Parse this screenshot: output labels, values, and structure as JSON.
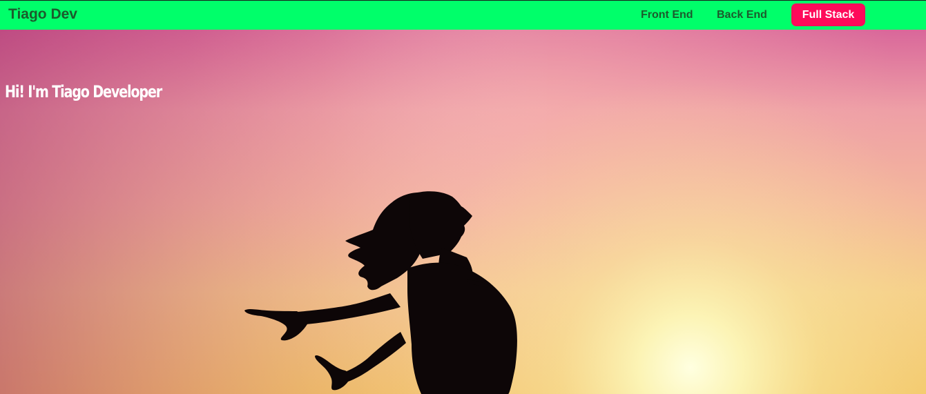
{
  "navbar": {
    "brand": "Tiago Dev",
    "links": [
      {
        "label": "Front End"
      },
      {
        "label": "Back End"
      },
      {
        "label": "Full Stack"
      }
    ],
    "colors": {
      "background": "#00ff6a",
      "link_text": "#1c5a2c",
      "active_button": "#ff0a5a"
    }
  },
  "hero": {
    "heading": "Hi! I'm Tiago Developer",
    "image": "sunset-silhouette-woman-arms-outstretched"
  }
}
